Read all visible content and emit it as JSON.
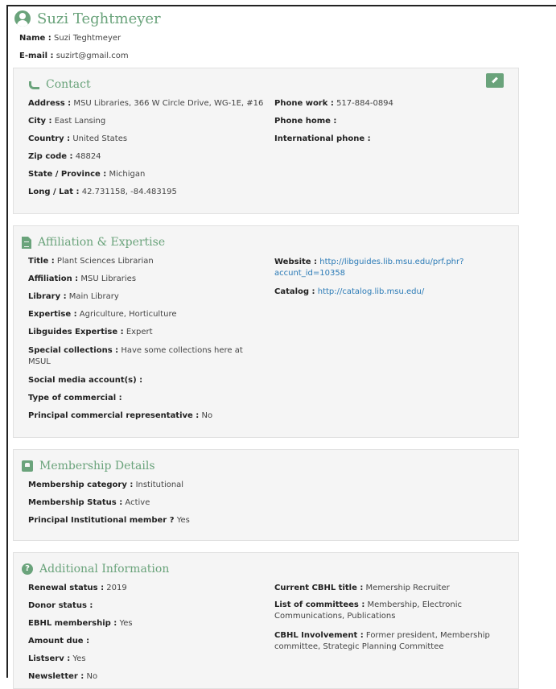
{
  "profile": {
    "name_heading": "Suzi Teghtmeyer",
    "name_label": "Name :",
    "name_value": "Suzi Teghtmeyer",
    "email_label": "E-mail :",
    "email_value": "suzirt@gmail.com"
  },
  "contact": {
    "title": "Contact",
    "left": [
      {
        "label": "Address :",
        "value": "MSU Libraries, 366 W Circle Drive, WG-1E, #16"
      },
      {
        "label": "City :",
        "value": "East Lansing"
      },
      {
        "label": "Country :",
        "value": "United States"
      },
      {
        "label": "Zip code :",
        "value": "48824"
      },
      {
        "label": "State / Province :",
        "value": "Michigan"
      },
      {
        "label": "Long / Lat :",
        "value": "42.731158, -84.483195"
      }
    ],
    "right": [
      {
        "label": "Phone work :",
        "value": "517-884-0894"
      },
      {
        "label": "Phone home :",
        "value": ""
      },
      {
        "label": "International phone :",
        "value": ""
      }
    ]
  },
  "affiliation": {
    "title": "Affiliation & Expertise",
    "left": [
      {
        "label": "Title :",
        "value": "Plant Sciences Librarian"
      },
      {
        "label": "Affiliation :",
        "value": "MSU Libraries"
      },
      {
        "label": "Library :",
        "value": "Main Library"
      },
      {
        "label": "Expertise :",
        "value": "Agriculture, Horticulture"
      },
      {
        "label": "Libguides Expertise :",
        "value": "Expert"
      },
      {
        "label": "Special collections :",
        "value": "Have some collections here at",
        "value2": "MSUL"
      },
      {
        "label": "Social media account(s) :",
        "value": ""
      },
      {
        "label": "Type of commercial :",
        "value": ""
      },
      {
        "label": "Principal commercial representative :",
        "value": "No"
      }
    ],
    "website_label": "Website :",
    "website_line1": "http://libguides.lib.msu.edu/prf.phr?",
    "website_line2": "accunt_id=10358",
    "catalog_label": "Catalog :",
    "catalog_value": "http://catalog.lib.msu.edu/"
  },
  "membership": {
    "title": "Membership Details",
    "left": [
      {
        "label": "Membership category :",
        "value": "Institutional"
      },
      {
        "label": "Membership Status :",
        "value": "Active"
      },
      {
        "label": "Principal Institutional member ?",
        "value": "Yes"
      }
    ]
  },
  "additional": {
    "title": "Additional Information",
    "left": [
      {
        "label": "Renewal status :",
        "value": "2019"
      },
      {
        "label": "Donor status :",
        "value": ""
      },
      {
        "label": "EBHL membership :",
        "value": "Yes"
      },
      {
        "label": "Amount due :",
        "value": ""
      },
      {
        "label": "Listserv :",
        "value": "Yes"
      },
      {
        "label": "Newsletter :",
        "value": "No"
      }
    ],
    "current_title_label": "Current CBHL title :",
    "current_title_value": "Memership Recruiter",
    "committees_label": "List of committees :",
    "committees_line1": "Membership, Electronic",
    "committees_line2": "Communications, Publications",
    "involvement_label": "CBHL Involvement :",
    "involvement_line1": "Former president, Membership",
    "involvement_line2": "committee, Strategic Planning Committee"
  },
  "colors": {
    "accent": "#6aa37b",
    "link": "#2a7ab6",
    "card_bg": "#f5f5f5"
  },
  "icons": [
    "user-circle-icon",
    "phone-icon",
    "document-icon",
    "id-badge-icon",
    "question-icon",
    "pencil-icon"
  ]
}
